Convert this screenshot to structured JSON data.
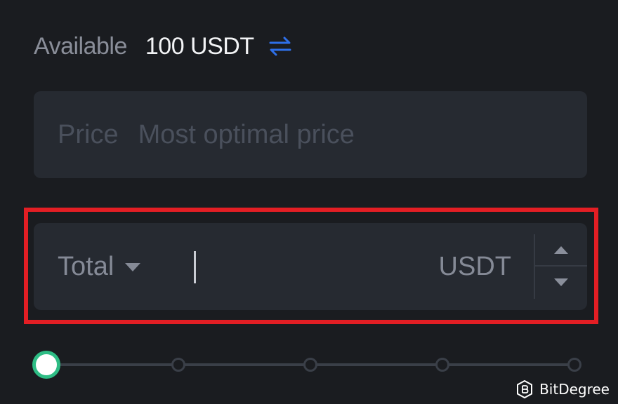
{
  "balance": {
    "label": "Available",
    "value": "100 USDT",
    "transfer_icon": "swap-arrows-icon",
    "accent_color": "#2e6fe8"
  },
  "price_field": {
    "label": "Price",
    "value": "Most optimal price"
  },
  "total_field": {
    "selector_label": "Total",
    "value": "",
    "unit": "USDT",
    "highlight_color": "#e31e24"
  },
  "slider": {
    "value_percent": 0,
    "stops_percent": [
      0,
      25,
      50,
      75,
      100
    ],
    "active_color": "#2ebd85"
  },
  "watermark": {
    "brand": "BitDegree"
  }
}
